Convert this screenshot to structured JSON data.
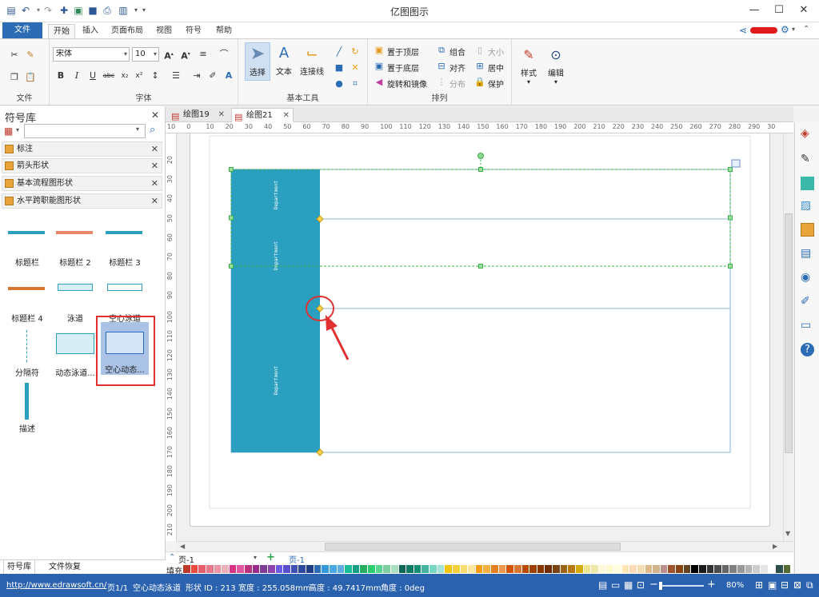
{
  "app": {
    "title": "亿图图示"
  },
  "window": {
    "minimize": "—",
    "maximize": "☐",
    "close": "✕"
  },
  "ribbon_tabs": [
    "文件",
    "开始",
    "插入",
    "页面布局",
    "视图",
    "符号",
    "帮助"
  ],
  "ribbon": {
    "groups": {
      "file": "文件",
      "font": "字体",
      "basic_tools": "基本工具",
      "arrange": "排列"
    },
    "font_name": "宋体",
    "font_size": "10",
    "tools": {
      "select": "选择",
      "text": "文本",
      "connector": "连接线"
    },
    "arrange": {
      "bring_front": "置于顶层",
      "send_back": "置于底层",
      "rotate_mirror": "旋转和镜像",
      "group": "组合",
      "align": "对齐",
      "distribute": "分布",
      "size": "大小",
      "center": "居中",
      "protect": "保护"
    },
    "style": "样式",
    "edit": "编辑"
  },
  "left_panel": {
    "title": "符号库",
    "search_placeholder": "",
    "categories": [
      "标注",
      "箭头形状",
      "基本流程图形状",
      "水平跨职能图形状"
    ],
    "shapes": [
      "标题栏",
      "标题栏 2",
      "标题栏 3",
      "标题栏 4",
      "泳道",
      "空心泳道",
      "分隔符",
      "动态泳道...",
      "空心动态...",
      "描述"
    ],
    "bottom_tabs": [
      "符号库",
      "文件恢复"
    ]
  },
  "doc_tabs": [
    {
      "label": "绘图19"
    },
    {
      "label": "绘图21"
    }
  ],
  "ruler": {
    "h": [
      "10",
      "0",
      "10",
      "20",
      "30",
      "40",
      "50",
      "60",
      "70",
      "80",
      "90",
      "100",
      "110",
      "120",
      "130",
      "140",
      "150",
      "160",
      "170",
      "180",
      "190",
      "200",
      "210",
      "220",
      "230",
      "240",
      "250",
      "260",
      "270",
      "280",
      "290",
      "30"
    ],
    "v": [
      "20",
      "30",
      "40",
      "50",
      "60",
      "70",
      "80",
      "90",
      "100",
      "110",
      "120",
      "130",
      "140",
      "150",
      "160",
      "170",
      "180",
      "190",
      "200",
      "210"
    ]
  },
  "diagram": {
    "lane_label": "Department"
  },
  "page_nav": {
    "page_select": "页-1",
    "page_tab": "页-1"
  },
  "palette": {
    "label": "填充",
    "colors": [
      "#c0392b",
      "#e74c3c",
      "#e35d6a",
      "#e7798a",
      "#ec94a3",
      "#f0b0bc",
      "#d63384",
      "#e056a0",
      "#b83280",
      "#9b2c8c",
      "#7d3c98",
      "#8e44ad",
      "#6c5ce7",
      "#5a4fcf",
      "#3f51b5",
      "#2e4a9e",
      "#1f3c88",
      "#2b6cb5",
      "#3498db",
      "#48a9e6",
      "#5dade2",
      "#1abc9c",
      "#16a085",
      "#27ae60",
      "#2ecc71",
      "#58d68d",
      "#7dcea0",
      "#a9dfbf",
      "#0e6655",
      "#117a65",
      "#138d75",
      "#45b39d",
      "#76d7c4",
      "#a3e4d7",
      "#f1c40f",
      "#f4d03f",
      "#f7dc6f",
      "#f9e79f",
      "#f39c12",
      "#f5b041",
      "#e67e22",
      "#eb984e",
      "#d35400",
      "#dc7633",
      "#ba4a00",
      "#a04000",
      "#873600",
      "#6e2c00",
      "#784212",
      "#9c640c",
      "#b9770e",
      "#d4ac0d",
      "#f0e68c",
      "#eee8aa",
      "#fff8dc",
      "#fffacd",
      "#ffffe0",
      "#ffe4b5",
      "#ffdab9",
      "#f5deb3",
      "#deb887",
      "#d2b48c",
      "#bc8f8f",
      "#a0522d",
      "#8b4513",
      "#654321",
      "#000000",
      "#1a1a1a",
      "#333333",
      "#4d4d4d",
      "#666666",
      "#808080",
      "#999999",
      "#b3b3b3",
      "#cccccc",
      "#e6e6e6",
      "#ffffff",
      "#2f4f4f",
      "#556b2f"
    ]
  },
  "status": {
    "url": "http://www.edrawsoft.cn/",
    "page": "页1/1",
    "shape_name": "空心动态泳道",
    "shape_id": "形状 ID : 213",
    "width": "宽度 : 255.058mm",
    "height": "高度 : 49.7417mm",
    "angle": "角度 : 0deg",
    "zoom": "80%"
  },
  "colors": {
    "lane": "#2a9fbf",
    "accent": "#2b6cb5",
    "highlight_circle": "#e03030"
  }
}
